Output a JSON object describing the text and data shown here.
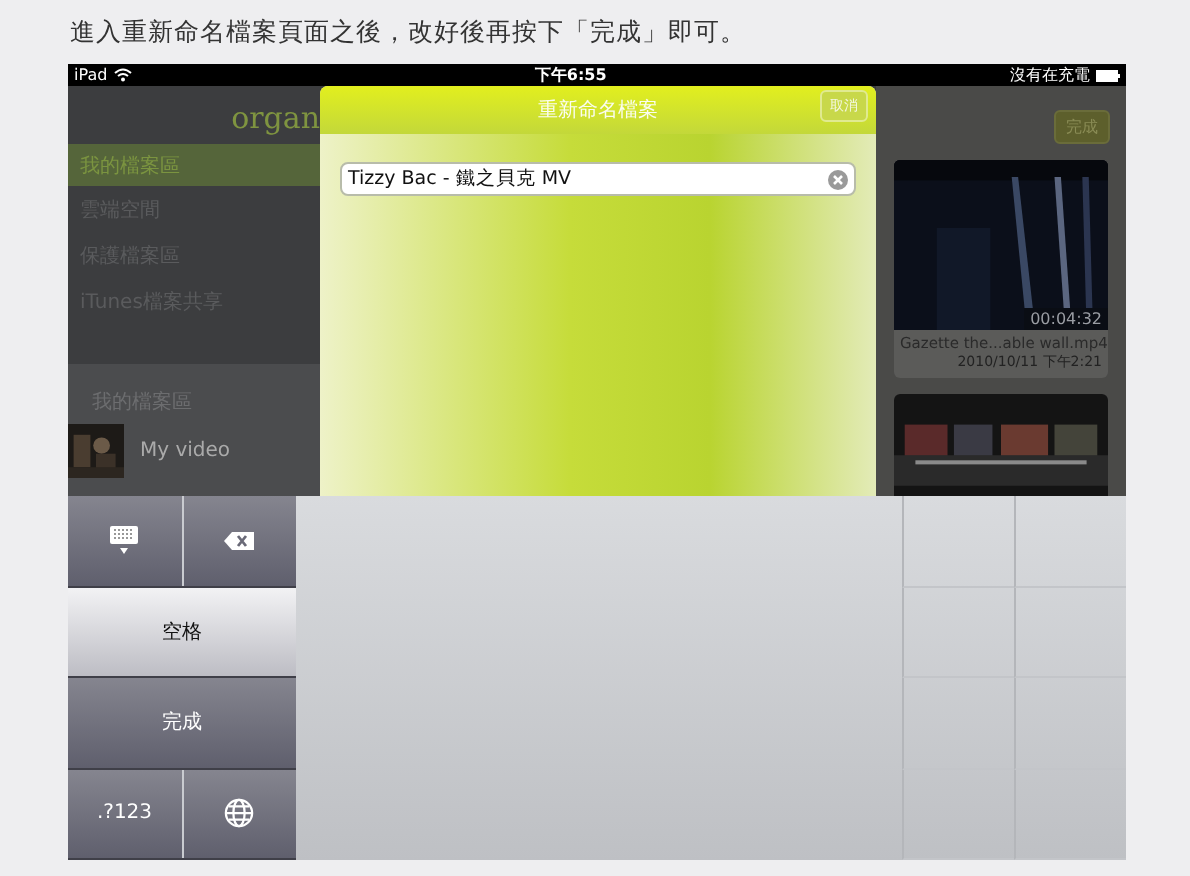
{
  "caption": "進入重新命名檔案頁面之後，改好後再按下「完成」即可。",
  "status_bar": {
    "device": "iPad",
    "time": "下午6:55",
    "charging": "沒有在充電"
  },
  "app": {
    "logo": "organ",
    "sidebar": {
      "items": [
        {
          "label": "我的檔案區",
          "selected": true
        },
        {
          "label": "雲端空間",
          "selected": false
        },
        {
          "label": "保護檔案區",
          "selected": false
        },
        {
          "label": "iTunes檔案共享",
          "selected": false
        }
      ],
      "section_title": "我的檔案區",
      "files": [
        {
          "title": "My video"
        }
      ]
    },
    "done_button": "完成",
    "videos": [
      {
        "kind": "full",
        "duration": "00:04:32",
        "name": "Gazette the...able wall.mp4",
        "date": "2010/10/11 下午2:21"
      },
      {
        "kind": "thumbnail-only"
      }
    ]
  },
  "dialog": {
    "title": "重新命名檔案",
    "cancel": "取消",
    "field_value": "Tizzy Bac - 鐵之貝克 MV"
  },
  "keyboard": {
    "rows": [
      [
        {
          "kind": "hide-keyboard"
        },
        {
          "kind": "backspace"
        }
      ],
      [
        {
          "kind": "text",
          "label": "空格",
          "highlighted": true
        }
      ],
      [
        {
          "kind": "text",
          "label": "完成",
          "highlighted": false
        }
      ],
      [
        {
          "kind": "text",
          "label": ".?123",
          "highlighted": false
        },
        {
          "kind": "globe"
        }
      ]
    ]
  }
}
